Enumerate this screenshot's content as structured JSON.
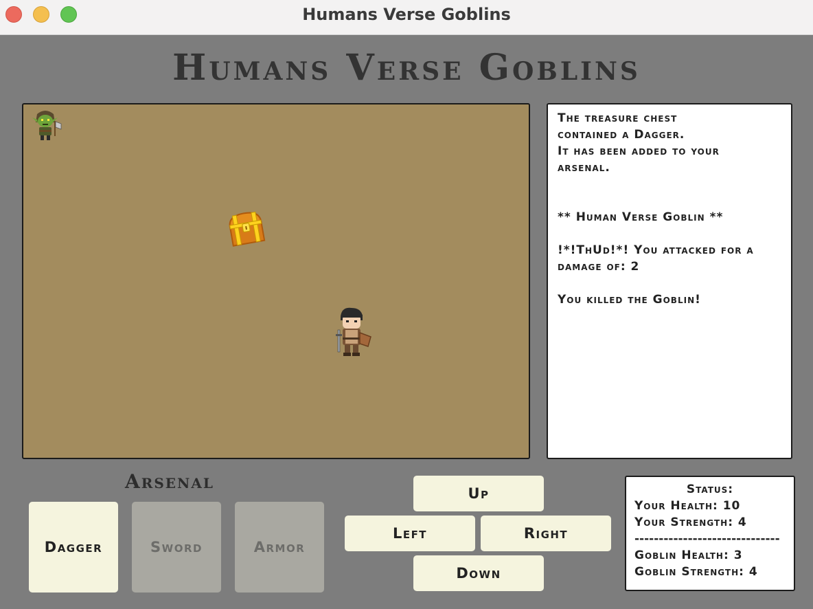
{
  "window": {
    "title": "Humans Verse Goblins"
  },
  "game": {
    "title": "Humans Verse Goblins"
  },
  "board": {
    "entities": [
      "goblin-icon",
      "treasure-chest-icon",
      "human-hero-icon"
    ]
  },
  "log": {
    "lines": [
      "The treasure chest",
      "contained a Dagger.",
      "It has been added to your",
      "arsenal.",
      "",
      "",
      "** Human Verse Goblin **",
      "",
      "!*!ThUd!*! You attacked for a",
      "damage of: 2",
      "",
      "You killed the Goblin!"
    ]
  },
  "arsenal": {
    "label": "Arsenal",
    "items": [
      {
        "label": "Dagger",
        "enabled": true
      },
      {
        "label": "Sword",
        "enabled": false
      },
      {
        "label": "Armor",
        "enabled": false
      }
    ]
  },
  "controls": {
    "up": "Up",
    "left": "Left",
    "right": "Right",
    "down": "Down"
  },
  "status": {
    "header": "Status:",
    "your_health": "Your Health: 10",
    "your_strength": "Your Strength: 4",
    "separator": "------------------------------",
    "goblin_health": "Goblin Health: 3",
    "goblin_strength": "Goblin Strength: 4"
  },
  "colors": {
    "background": "#7d7d7d",
    "board": "#a38c5e",
    "button": "#f5f4de",
    "button_disabled": "#a9a8a1"
  }
}
